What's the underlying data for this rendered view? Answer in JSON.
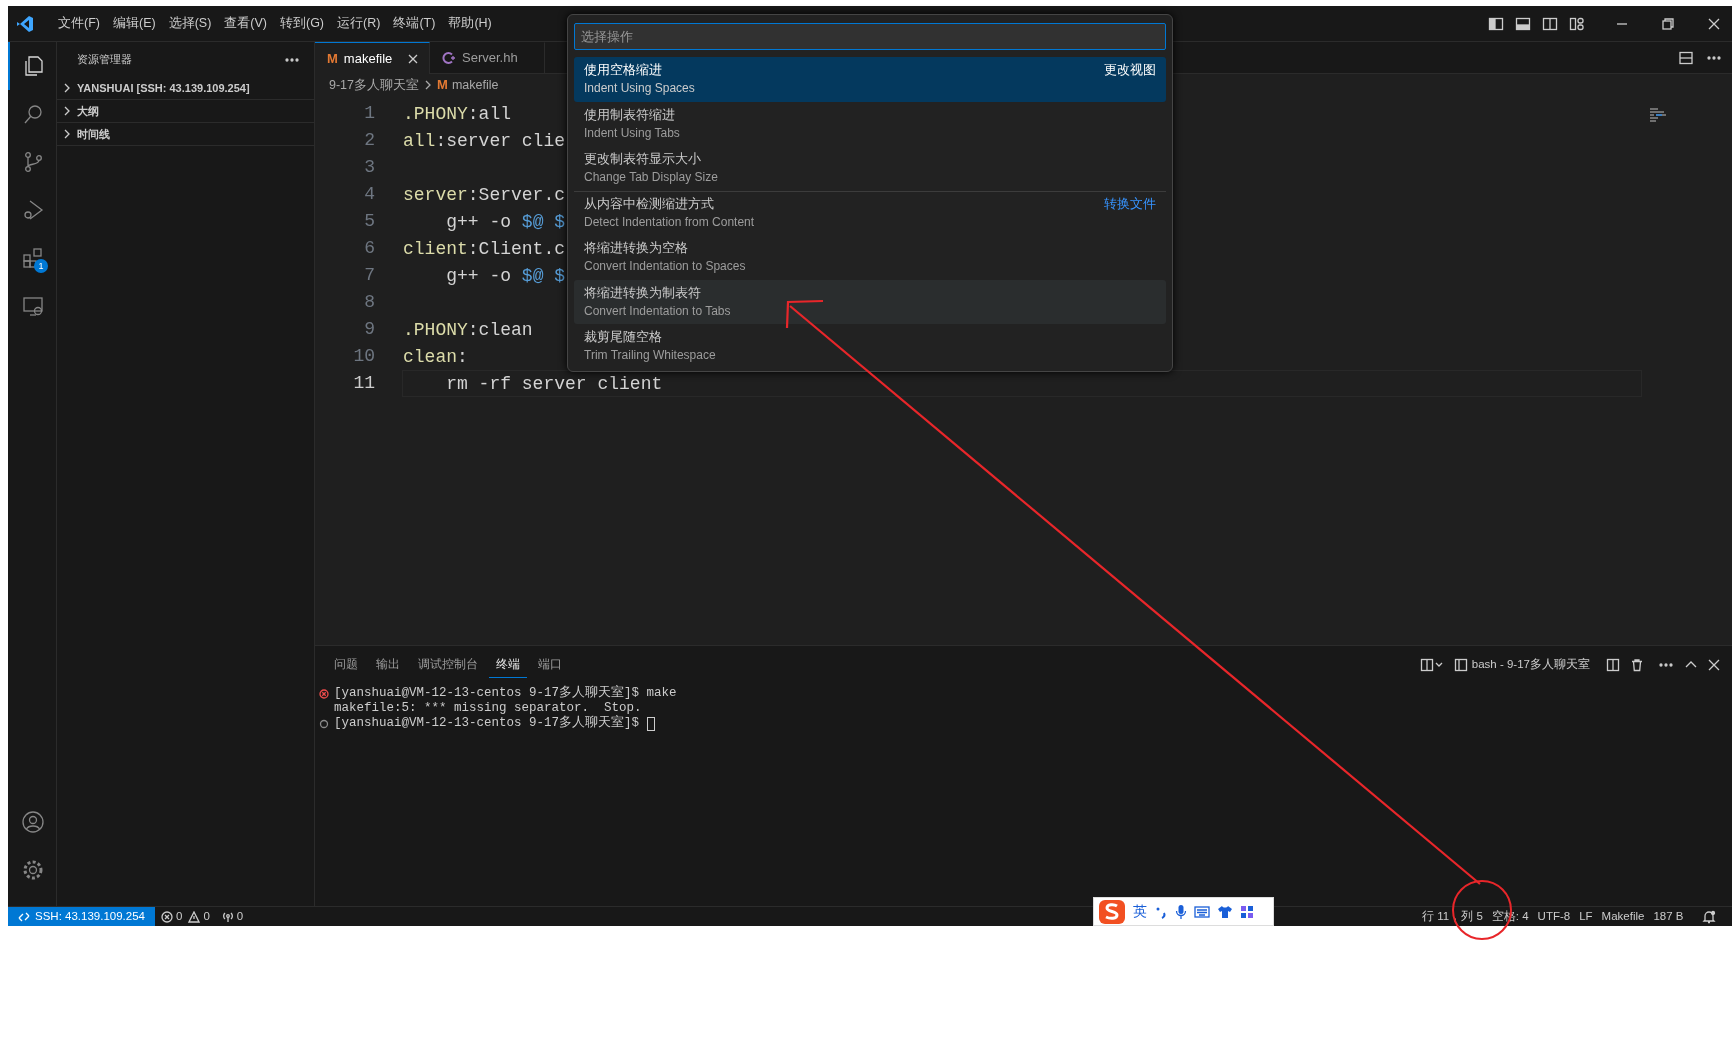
{
  "window": {
    "menu": [
      "文件(F)",
      "编辑(E)",
      "选择(S)",
      "查看(V)",
      "转到(G)",
      "运行(R)",
      "终端(T)",
      "帮助(H)"
    ]
  },
  "activity_bar": [
    {
      "kind": "files",
      "selected": true
    },
    {
      "kind": "search",
      "selected": false
    },
    {
      "kind": "source-control",
      "selected": false
    },
    {
      "kind": "run",
      "selected": false
    },
    {
      "kind": "extensions",
      "selected": false,
      "badge": "1"
    },
    {
      "kind": "remote",
      "selected": false
    }
  ],
  "activity_bar_bottom": [
    {
      "kind": "account"
    },
    {
      "kind": "settings"
    }
  ],
  "sidebar": {
    "title": "资源管理器",
    "sections": [
      {
        "label": "YANSHUAI [SSH: 43.139.109.254]",
        "expanded": false
      },
      {
        "label": "大纲",
        "expanded": false
      },
      {
        "label": "时间线",
        "expanded": false
      }
    ]
  },
  "tabs": [
    {
      "label": "makefile",
      "kind": "makefile",
      "icon_text": "M",
      "selected": true
    },
    {
      "label": "Server.hh",
      "kind": "cpp",
      "selected": false
    }
  ],
  "breadcrumbs": [
    {
      "label": "9-17多人聊天室",
      "kind": "folder"
    },
    {
      "label": "makefile",
      "kind": "makefile",
      "icon_text": "M"
    }
  ],
  "editor": {
    "lines": [
      {
        "number": "1",
        "current": false,
        "tokens": [
          {
            "text": ".PHONY",
            "kind": "target"
          },
          {
            "text": ":all",
            "kind": "plain"
          }
        ]
      },
      {
        "number": "2",
        "current": false,
        "tokens": [
          {
            "text": "all",
            "kind": "target"
          },
          {
            "text": ":server clie",
            "kind": "plain"
          }
        ]
      },
      {
        "number": "3",
        "current": false
      },
      {
        "number": "4",
        "current": false,
        "tokens": [
          {
            "text": "server",
            "kind": "target"
          },
          {
            "text": ":Server.c",
            "kind": "plain"
          }
        ]
      },
      {
        "number": "5",
        "current": false,
        "tokens": [
          {
            "text": "    g++ -o ",
            "kind": "plain"
          },
          {
            "text": "$@ $",
            "kind": "variable"
          }
        ]
      },
      {
        "number": "6",
        "current": false,
        "tokens": [
          {
            "text": "client",
            "kind": "target"
          },
          {
            "text": ":Client.c",
            "kind": "plain"
          }
        ]
      },
      {
        "number": "7",
        "current": false,
        "tokens": [
          {
            "text": "    g++ -o ",
            "kind": "plain"
          },
          {
            "text": "$@ $",
            "kind": "variable"
          }
        ]
      },
      {
        "number": "8",
        "current": false
      },
      {
        "number": "9",
        "current": false,
        "tokens": [
          {
            "text": ".PHONY",
            "kind": "target"
          },
          {
            "text": ":clean",
            "kind": "plain"
          }
        ]
      },
      {
        "number": "10",
        "current": false,
        "tokens": [
          {
            "text": "clean",
            "kind": "target"
          },
          {
            "text": ":",
            "kind": "plain"
          }
        ]
      },
      {
        "number": "11",
        "current": true,
        "tokens": [
          {
            "text": "    rm -rf server client",
            "kind": "plain"
          }
        ]
      }
    ]
  },
  "command_palette": {
    "placeholder": "选择操作",
    "items": [
      {
        "label": "使用空格缩进",
        "detail": "Indent Using Spaces",
        "group": "更改视图",
        "selected": true,
        "hovered": false,
        "separator_before": false
      },
      {
        "label": "使用制表符缩进",
        "detail": "Indent Using Tabs",
        "selected": false,
        "hovered": false,
        "separator_before": false
      },
      {
        "label": "更改制表符显示大小",
        "detail": "Change Tab Display Size",
        "selected": false,
        "hovered": false,
        "separator_before": false
      },
      {
        "label": "从内容中检测缩进方式",
        "detail": "Detect Indentation from Content",
        "group": "转换文件",
        "selected": false,
        "hovered": false,
        "separator_before": true
      },
      {
        "label": "将缩进转换为空格",
        "detail": "Convert Indentation to Spaces",
        "selected": false,
        "hovered": false,
        "separator_before": false
      },
      {
        "label": "将缩进转换为制表符",
        "detail": "Convert Indentation to Tabs",
        "selected": false,
        "hovered": true,
        "separator_before": false
      },
      {
        "label": "裁剪尾随空格",
        "detail": "Trim Trailing Whitespace",
        "selected": false,
        "hovered": false,
        "separator_before": false
      }
    ]
  },
  "panel": {
    "tabs": [
      {
        "label": "问题",
        "selected": false
      },
      {
        "label": "输出",
        "selected": false
      },
      {
        "label": "调试控制台",
        "selected": false
      },
      {
        "label": "终端",
        "selected": true
      },
      {
        "label": "端口",
        "selected": false
      }
    ],
    "terminal_title": "bash - 9-17多人聊天室",
    "terminal": [
      {
        "kind": "error",
        "text": "[yanshuai@VM-12-13-centos 9-17多人聊天室]$ make"
      },
      {
        "kind": "output",
        "text": "makefile:5: *** missing separator.  Stop."
      },
      {
        "kind": "idle",
        "text": "[yanshuai@VM-12-13-centos 9-17多人聊天室]$",
        "cursor": true
      }
    ]
  },
  "status_bar": {
    "remote": "SSH: 43.139.109.254",
    "errors": "0",
    "warnings": "0",
    "ports": "0",
    "right": [
      "行 11，列 5",
      "空格: 4",
      "UTF-8",
      "LF",
      "Makefile",
      "187 B"
    ],
    "ime": {
      "lang": "英"
    }
  },
  "annotations": {
    "arrow": true,
    "circle": true
  }
}
